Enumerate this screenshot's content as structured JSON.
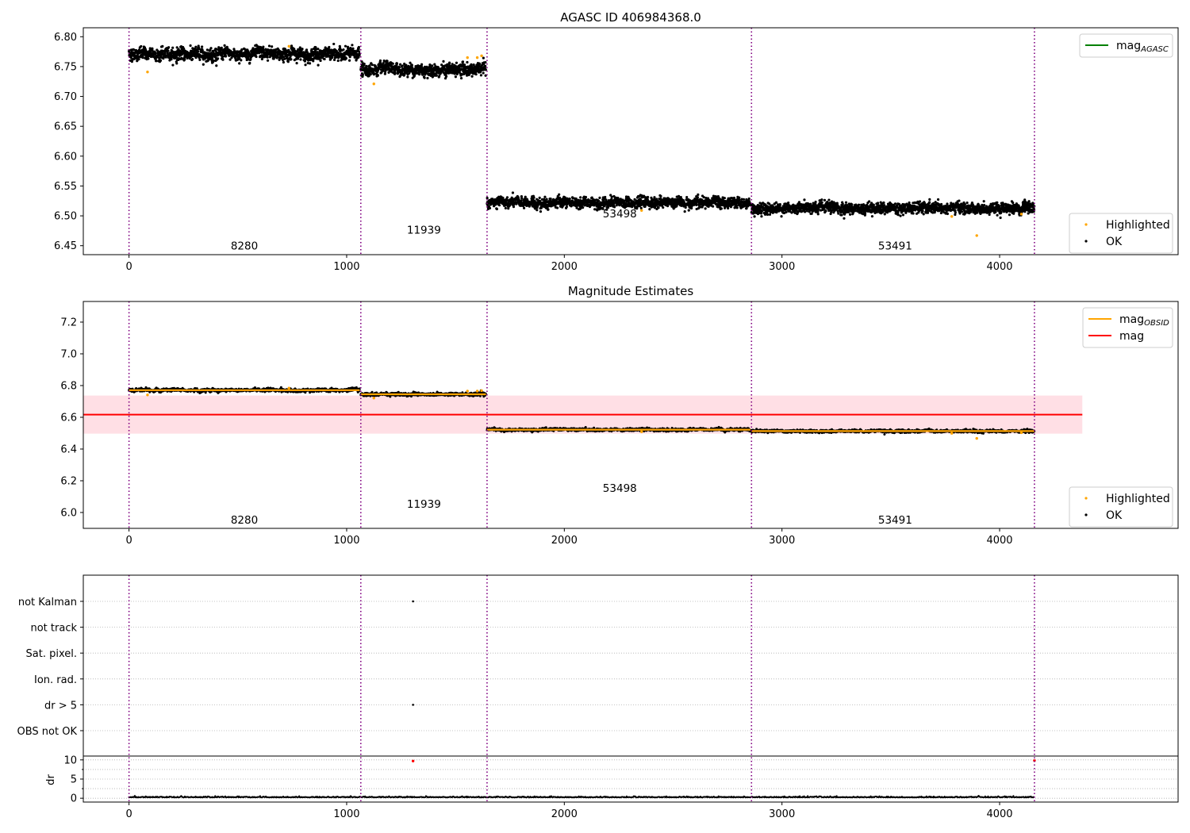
{
  "chart_data": [
    {
      "type": "scatter",
      "title": "AGASC ID 406984368.0",
      "xlim": [
        -210,
        4820
      ],
      "ylim": [
        6.435,
        6.815
      ],
      "x_ticks": [
        0,
        1000,
        2000,
        3000,
        4000
      ],
      "y_ticks": [
        6.45,
        6.5,
        6.55,
        6.6,
        6.65,
        6.7,
        6.75,
        6.8
      ],
      "legend_top": {
        "position": "top-right",
        "entries": [
          {
            "label": "mag",
            "sub": "AGASC",
            "color": "#008000",
            "style": "line"
          }
        ]
      },
      "legend_bottom": {
        "position": "bottom-right",
        "entries": [
          {
            "label": "Highlighted",
            "color": "#ffa500",
            "style": "point"
          },
          {
            "label": "OK",
            "color": "#000000",
            "style": "point"
          }
        ]
      },
      "obs_boundaries": [
        0,
        1065,
        1645,
        2860,
        4160
      ],
      "obs_labels": [
        {
          "text": "8280",
          "x": 530,
          "y": 6.45
        },
        {
          "text": "11939",
          "x": 1355,
          "y": 6.477
        },
        {
          "text": "53498",
          "x": 2255,
          "y": 6.504
        },
        {
          "text": "53491",
          "x": 3520,
          "y": 6.45
        }
      ],
      "segments": [
        {
          "x": [
            0,
            1060
          ],
          "mean": 6.771,
          "spread": 0.007
        },
        {
          "x": [
            1065,
            1640
          ],
          "mean": 6.745,
          "spread": 0.007
        },
        {
          "x": [
            1645,
            2855
          ],
          "mean": 6.522,
          "spread": 0.006
        },
        {
          "x": [
            2860,
            4160
          ],
          "mean": 6.513,
          "spread": 0.006
        }
      ],
      "highlighted_points": [
        {
          "x": 85,
          "y": 6.741
        },
        {
          "x": 1125,
          "y": 6.721
        },
        {
          "x": 1555,
          "y": 6.765
        },
        {
          "x": 1600,
          "y": 6.765
        },
        {
          "x": 1620,
          "y": 6.768
        },
        {
          "x": 735,
          "y": 6.784
        },
        {
          "x": 2355,
          "y": 6.509
        },
        {
          "x": 3780,
          "y": 6.499
        },
        {
          "x": 3895,
          "y": 6.467
        },
        {
          "x": 4100,
          "y": 6.503
        }
      ]
    },
    {
      "type": "scatter",
      "title": "Magnitude Estimates",
      "xlim": [
        -210,
        4820
      ],
      "ylim": [
        5.9,
        7.33
      ],
      "x_ticks": [
        0,
        1000,
        2000,
        3000,
        4000
      ],
      "y_ticks": [
        6.0,
        6.2,
        6.4,
        6.6,
        6.8,
        7.0,
        7.2
      ],
      "y_tick_labels": [
        "6.0",
        "6.2",
        "6.4",
        "6.6",
        "6.8",
        "7.0",
        "7.2"
      ],
      "legend_top": {
        "position": "top-right",
        "entries": [
          {
            "label": "mag",
            "sub": "OBSID",
            "color": "#ffa500",
            "style": "line"
          },
          {
            "label": "mag",
            "sub": "",
            "color": "#ff0000",
            "style": "line"
          }
        ]
      },
      "legend_bottom": {
        "position": "bottom-right",
        "entries": [
          {
            "label": "Highlighted",
            "color": "#ffa500",
            "style": "point"
          },
          {
            "label": "OK",
            "color": "#000000",
            "style": "point"
          }
        ]
      },
      "mag": 6.617,
      "mag_band": [
        6.497,
        6.737
      ],
      "mag_line_x": [
        -210,
        4380
      ],
      "obs_mag": [
        {
          "x": [
            0,
            1060
          ],
          "mag": 6.771
        },
        {
          "x": [
            1065,
            1640
          ],
          "mag": 6.745
        },
        {
          "x": [
            1645,
            2855
          ],
          "mag": 6.522
        },
        {
          "x": [
            2860,
            4160
          ],
          "mag": 6.513
        }
      ],
      "obs_labels": [
        {
          "text": "8280",
          "x": 530,
          "y": 5.955
        },
        {
          "text": "11939",
          "x": 1355,
          "y": 6.055
        },
        {
          "text": "53498",
          "x": 2255,
          "y": 6.155
        },
        {
          "text": "53491",
          "x": 3520,
          "y": 5.955
        }
      ]
    },
    {
      "type": "scatter",
      "title": "",
      "xlim": [
        -210,
        4820
      ],
      "x_ticks": [
        0,
        1000,
        2000,
        3000,
        4000
      ],
      "flag_rows": [
        "not Kalman",
        "not track",
        "Sat. pixel.",
        "Ion. rad.",
        "dr > 5",
        "OBS not OK"
      ],
      "flag_points": [
        {
          "row": "not Kalman",
          "x": 1305
        },
        {
          "row": "dr > 5",
          "x": 1305
        }
      ],
      "dr_ylim": [
        -1,
        11
      ],
      "dr_ylabel": "dr",
      "dr_ticks": [
        0,
        5,
        10
      ],
      "dr_outliers": [
        {
          "x": 1305,
          "y": 9.7
        },
        {
          "x": 4160,
          "y": 9.8
        }
      ],
      "dr_typical": 0.2
    }
  ]
}
